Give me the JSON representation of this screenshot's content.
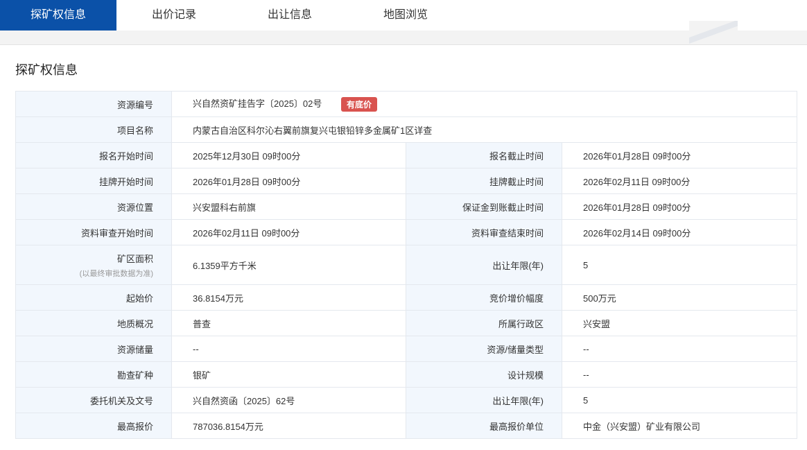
{
  "tabs": [
    {
      "label": "探矿权信息",
      "active": true
    },
    {
      "label": "出价记录",
      "active": false
    },
    {
      "label": "出让信息",
      "active": false
    },
    {
      "label": "地图浏览",
      "active": false
    }
  ],
  "section_title": "探矿权信息",
  "badge": "有底价",
  "rows": {
    "resource_no": {
      "label": "资源编号",
      "value": "兴自然资矿挂告字〔2025〕02号"
    },
    "project_name": {
      "label": "项目名称",
      "value": "内蒙古自治区科尔沁右翼前旗复兴屯银铅锌多金属矿1区详查"
    },
    "reg_start": {
      "label": "报名开始时间",
      "value": "2025年12月30日 09时00分"
    },
    "reg_end": {
      "label": "报名截止时间",
      "value": "2026年01月28日 09时00分"
    },
    "list_start": {
      "label": "挂牌开始时间",
      "value": "2026年01月28日 09时00分"
    },
    "list_end": {
      "label": "挂牌截止时间",
      "value": "2026年02月11日 09时00分"
    },
    "location": {
      "label": "资源位置",
      "value": "兴安盟科右前旗"
    },
    "deposit_deadline": {
      "label": "保证金到账截止时间",
      "value": "2026年01月28日 09时00分"
    },
    "review_start": {
      "label": "资料审查开始时间",
      "value": "2026年02月11日 09时00分"
    },
    "review_end": {
      "label": "资料审查结束时间",
      "value": "2026年02月14日 09时00分"
    },
    "area": {
      "label": "矿区面积",
      "note": "(以最终审批数据为准)",
      "value": "6.1359平方千米"
    },
    "term1": {
      "label": "出让年限(年)",
      "value": "5"
    },
    "start_price": {
      "label": "起始价",
      "value": "36.8154万元"
    },
    "increment": {
      "label": "竞价增价幅度",
      "value": "500万元"
    },
    "geology": {
      "label": "地质概况",
      "value": "普查"
    },
    "district": {
      "label": "所属行政区",
      "value": "兴安盟"
    },
    "reserves": {
      "label": "资源储量",
      "value": "--"
    },
    "reserve_type": {
      "label": "资源/储量类型",
      "value": "--"
    },
    "mineral": {
      "label": "勘查矿种",
      "value": "银矿"
    },
    "scale": {
      "label": "设计规模",
      "value": "--"
    },
    "agency": {
      "label": "委托机关及文号",
      "value": "兴自然资函〔2025〕62号"
    },
    "term2": {
      "label": "出让年限(年)",
      "value": "5"
    },
    "top_bid": {
      "label": "最高报价",
      "value": "787036.8154万元"
    },
    "top_bidder": {
      "label": "最高报价单位",
      "value": "中金（兴安盟）矿业有限公司"
    }
  }
}
